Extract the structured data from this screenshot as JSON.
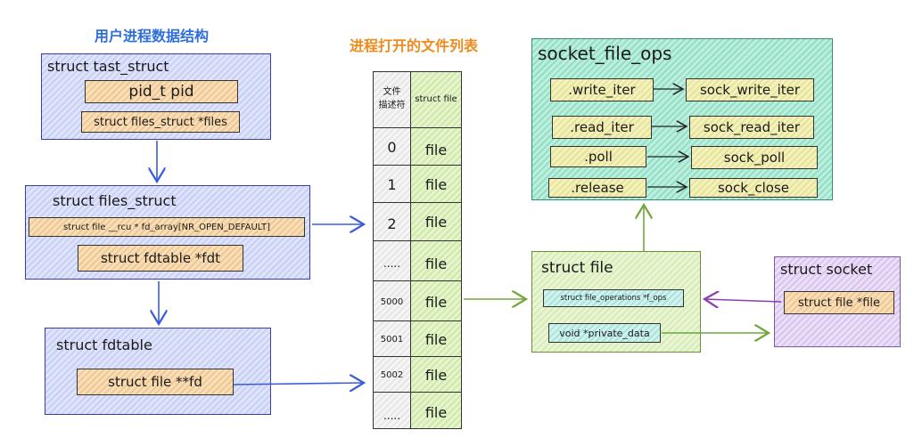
{
  "titles": {
    "user_struct": "用户进程数据结构",
    "file_table": "进程打开的文件列表"
  },
  "task_struct": {
    "title": "struct  tast_struct",
    "pid": "pid_t  pid",
    "files": "struct  files_struct *files"
  },
  "files_struct": {
    "title": "struct files_struct",
    "fd_array": "struct file __rcu * fd_array[NR_OPEN_DEFAULT]",
    "fdt": "struct fdtable *fdt"
  },
  "fdtable": {
    "title": "struct fdtable",
    "fd": "struct file **fd"
  },
  "table": {
    "header_fd_line1": "文件",
    "header_fd_line2": "描述符",
    "header_file": "struct file",
    "rows": [
      {
        "fd": "0",
        "file": "file"
      },
      {
        "fd": "1",
        "file": "file"
      },
      {
        "fd": "2",
        "file": "file"
      },
      {
        "fd": ".....",
        "file": "file"
      },
      {
        "fd": "5000",
        "file": "file"
      },
      {
        "fd": "5001",
        "file": "file"
      },
      {
        "fd": "5002",
        "file": "file"
      },
      {
        "fd": ".....",
        "file": "file"
      }
    ]
  },
  "socket_file_ops": {
    "title": "socket_file_ops",
    "ops": [
      {
        "op": ".write_iter",
        "fn": "sock_write_iter"
      },
      {
        "op": ".read_iter",
        "fn": "sock_read_iter"
      },
      {
        "op": ".poll",
        "fn": "sock_poll"
      },
      {
        "op": ".release",
        "fn": "sock_close"
      }
    ]
  },
  "struct_file": {
    "title": "struct file",
    "f_ops": "struct file_operations *f_ops",
    "private_data": "void *private_data"
  },
  "struct_socket": {
    "title": "struct socket",
    "file": "struct file *file"
  },
  "colors": {
    "blue_arrow": "#3b5bdb",
    "green_arrow": "#6fa83a",
    "purple_arrow": "#8a3fb0"
  }
}
